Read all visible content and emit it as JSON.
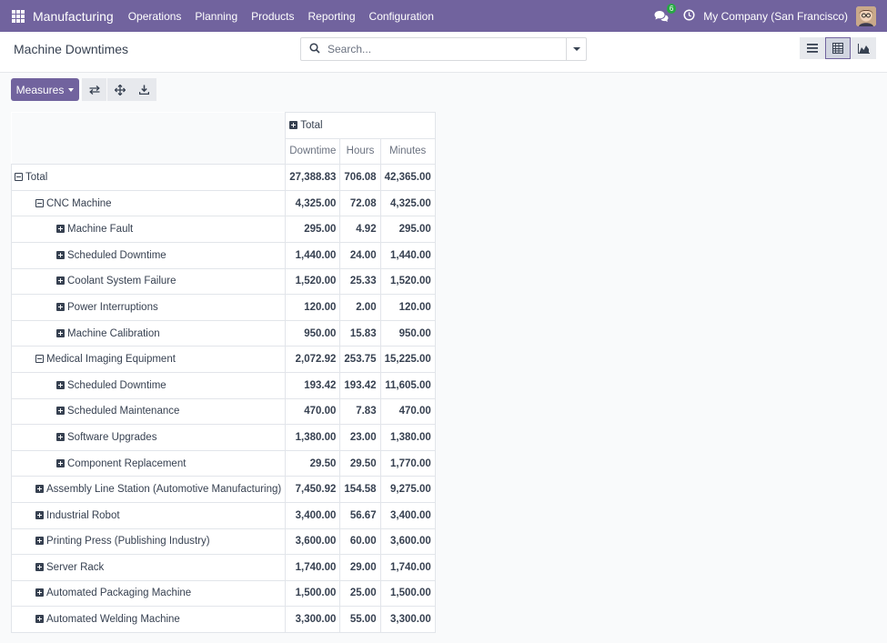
{
  "navbar": {
    "brand": "Manufacturing",
    "menus": [
      "Operations",
      "Planning",
      "Products",
      "Reporting",
      "Configuration"
    ],
    "chat_badge": "6",
    "company": "My Company (San Francisco)"
  },
  "control": {
    "title": "Machine Downtimes",
    "search_placeholder": "Search..."
  },
  "toolbar": {
    "measures_label": "Measures"
  },
  "pivot": {
    "col_header": "Total",
    "measures": [
      "Downtime",
      "Hours",
      "Minutes"
    ],
    "rows": [
      {
        "label": "Total",
        "level": 0,
        "expanded": true,
        "values": [
          "27,388.83",
          "706.08",
          "42,365.00"
        ]
      },
      {
        "label": "CNC Machine",
        "level": 1,
        "expanded": true,
        "values": [
          "4,325.00",
          "72.08",
          "4,325.00"
        ]
      },
      {
        "label": "Machine Fault",
        "level": 2,
        "expanded": false,
        "values": [
          "295.00",
          "4.92",
          "295.00"
        ]
      },
      {
        "label": "Scheduled Downtime",
        "level": 2,
        "expanded": false,
        "values": [
          "1,440.00",
          "24.00",
          "1,440.00"
        ]
      },
      {
        "label": "Coolant System Failure",
        "level": 2,
        "expanded": false,
        "values": [
          "1,520.00",
          "25.33",
          "1,520.00"
        ]
      },
      {
        "label": "Power Interruptions",
        "level": 2,
        "expanded": false,
        "values": [
          "120.00",
          "2.00",
          "120.00"
        ]
      },
      {
        "label": "Machine Calibration",
        "level": 2,
        "expanded": false,
        "values": [
          "950.00",
          "15.83",
          "950.00"
        ]
      },
      {
        "label": "Medical Imaging Equipment",
        "level": 1,
        "expanded": true,
        "values": [
          "2,072.92",
          "253.75",
          "15,225.00"
        ]
      },
      {
        "label": "Scheduled Downtime",
        "level": 2,
        "expanded": false,
        "values": [
          "193.42",
          "193.42",
          "11,605.00"
        ]
      },
      {
        "label": "Scheduled Maintenance",
        "level": 2,
        "expanded": false,
        "values": [
          "470.00",
          "7.83",
          "470.00"
        ]
      },
      {
        "label": "Software Upgrades",
        "level": 2,
        "expanded": false,
        "values": [
          "1,380.00",
          "23.00",
          "1,380.00"
        ]
      },
      {
        "label": "Component Replacement",
        "level": 2,
        "expanded": false,
        "values": [
          "29.50",
          "29.50",
          "1,770.00"
        ]
      },
      {
        "label": "Assembly Line Station (Automotive Manufacturing)",
        "level": 1,
        "expanded": false,
        "values": [
          "7,450.92",
          "154.58",
          "9,275.00"
        ]
      },
      {
        "label": "Industrial Robot",
        "level": 1,
        "expanded": false,
        "values": [
          "3,400.00",
          "56.67",
          "3,400.00"
        ]
      },
      {
        "label": "Printing Press (Publishing Industry)",
        "level": 1,
        "expanded": false,
        "values": [
          "3,600.00",
          "60.00",
          "3,600.00"
        ]
      },
      {
        "label": "Server Rack",
        "level": 1,
        "expanded": false,
        "values": [
          "1,740.00",
          "29.00",
          "1,740.00"
        ]
      },
      {
        "label": "Automated Packaging Machine",
        "level": 1,
        "expanded": false,
        "values": [
          "1,500.00",
          "25.00",
          "1,500.00"
        ]
      },
      {
        "label": "Automated Welding Machine",
        "level": 1,
        "expanded": false,
        "values": [
          "3,300.00",
          "55.00",
          "3,300.00"
        ]
      }
    ]
  },
  "colors": {
    "brand": "#71639e",
    "badge": "#28a745"
  }
}
